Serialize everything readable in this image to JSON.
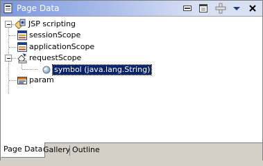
{
  "view": {
    "title": "Page Data",
    "toolbar": {
      "icons": [
        "minimize-view-icon",
        "new-page-data-icon",
        "add-data-icon",
        "view-menu-icon",
        "close-view-icon"
      ]
    }
  },
  "tree": {
    "root": {
      "label": "JSP scripting",
      "icon": "jsp-scripting-icon"
    },
    "children": [
      {
        "label": "sessionScope",
        "icon": "scope-icon"
      },
      {
        "label": "applicationScope",
        "icon": "scope-icon"
      },
      {
        "label": "requestScope",
        "icon": "request-scope-icon"
      },
      {
        "label": "symbol (java.lang.String)",
        "icon": "variable-icon",
        "selected": true
      },
      {
        "label": "param",
        "icon": "param-icon"
      }
    ]
  },
  "tabs": [
    {
      "label": "Page Data",
      "active": true
    },
    {
      "label": "Gallery",
      "active": false
    },
    {
      "label": "Outline",
      "active": false
    }
  ],
  "colors": {
    "selection": "#0a246a",
    "title_gradient_start": "#7a96df",
    "panel": "#d4d0c8"
  }
}
